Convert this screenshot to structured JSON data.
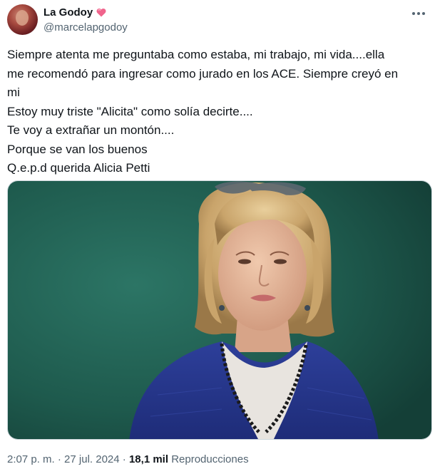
{
  "author": {
    "display_name": "La Godoy",
    "handle": "@marcelapgodoy",
    "badge_icon": "heart-icon",
    "badge_color": "#e0245e"
  },
  "tweet": {
    "lines": [
      "Siempre atenta me preguntaba como estaba, mi trabajo, mi vida....ella",
      "me recomendó para ingresar como jurado en los ACE. Siempre creyó en",
      "mi",
      "Estoy muy triste \"Alicita\" como solía decirte....",
      "Te voy a extrañar un montón....",
      "Porque se van los buenos",
      "Q.e.p.d querida Alicia Petti"
    ]
  },
  "media": {
    "background_color": "#1f5b4f"
  },
  "meta": {
    "time": "2:07 p. m.",
    "separator": "·",
    "date": "27 jul. 2024",
    "separator2": "·",
    "views_count": "18,1 mil",
    "views_label": "Reproducciones"
  },
  "more_icon": "more-dots-icon"
}
